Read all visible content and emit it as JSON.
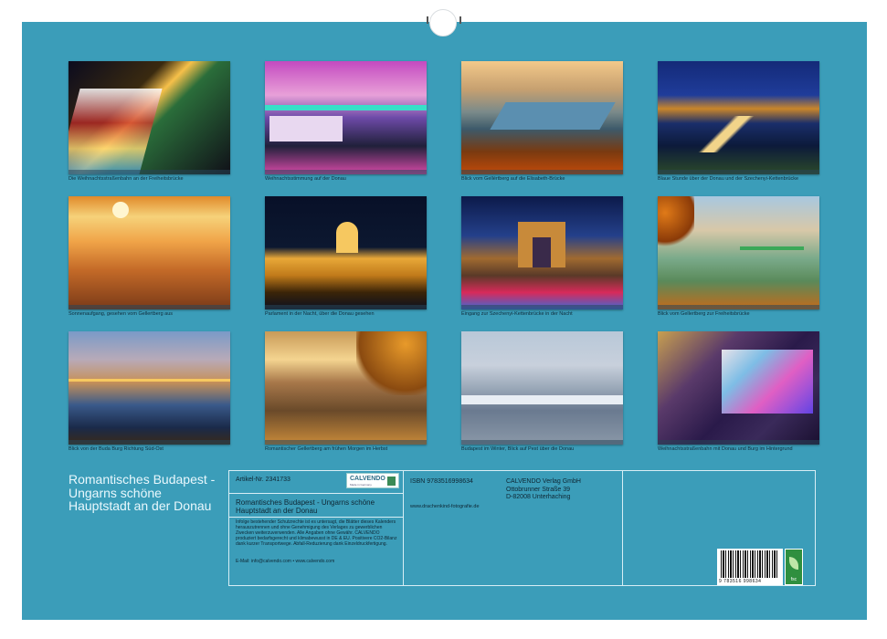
{
  "calendar": {
    "title": "Romantisches Budapest - Ungarns schöne Hauptstadt an der Donau",
    "photos": [
      {
        "caption": "Die Weihnachtsstraßenbahn an der Freiheitsbrücke"
      },
      {
        "caption": "Weihnachtsstimmung auf der Donau"
      },
      {
        "caption": "Blick vom Gellértberg auf die Elisabeth-Brücke"
      },
      {
        "caption": "Blaue Stunde über der Donau und der Szechenyi-Kettenbrücke"
      },
      {
        "caption": "Sonnenaufgang, gesehen vom Gellertberg aus"
      },
      {
        "caption": "Parlament in der Nacht, über die Donau gesehen"
      },
      {
        "caption": "Eingang zur Szechenyi-Kettenbrücke in der Nacht"
      },
      {
        "caption": "Blick vom Gellertberg zur Freiheitsbrücke"
      },
      {
        "caption": "Blick von der Buda Burg Richtung Süd-Ost"
      },
      {
        "caption": "Romantischer Gellertberg am frühen Morgen im Herbst"
      },
      {
        "caption": "Budapest im Winter, Blick auf Pest über die Donau"
      },
      {
        "caption": "Weihnachtsstraßenbahn mit Donau und Burg im Hintergrund"
      }
    ]
  },
  "info": {
    "article": "Artikel-Nr. 2341733",
    "logo_text": "CALVENDO",
    "logo_sub": "Made in Germany",
    "product_title": "Romantisches Budapest - Ungarns schöne Hauptstadt an der Donau",
    "legal_text": "Infolge bestehender Schutzrechte ist es untersagt, die Blätter dieses Kalenders herauszutrennen und ohne Genehmigung des Verlages zu gewerblichen Zwecken weiterzuverwenden. Alle Angaben ohne Gewähr. CALVENDO produziert bedarfsgerecht und klimabewusst in DE & EU. Positivere CO2-Bilanz dank kurzer Transportwege. Abfall-Reduzierung dank Einzeldruckfertigung.",
    "email": "E-Mail: info@calvendo.com • www.calvendo.com",
    "isbn": "ISBN 9783516998634",
    "website": "www.drachenkind-fotografie.de",
    "publisher": [
      "CALVENDO Verlag GmbH",
      "Ottobrunner Straße 39",
      "D-82008 Unterhaching"
    ],
    "barcode_number": "9 783516 998634",
    "fsc_label": "fsc"
  }
}
